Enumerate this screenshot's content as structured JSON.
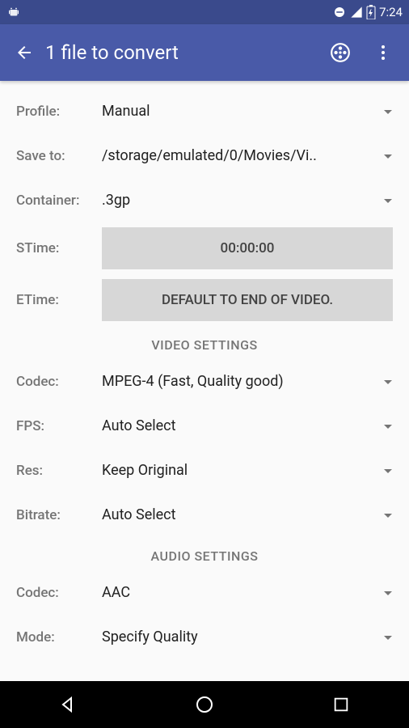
{
  "status": {
    "time": "7:24"
  },
  "appbar": {
    "title": "1 file to convert"
  },
  "rows": {
    "profile": {
      "label": "Profile:",
      "value": "Manual"
    },
    "saveto": {
      "label": "Save to:",
      "value": "/storage/emulated/0/Movies/Vi.."
    },
    "container": {
      "label": "Container:",
      "value": ".3gp"
    },
    "stime": {
      "label": "STime:",
      "button": "00:00:00"
    },
    "etime": {
      "label": "ETime:",
      "button": "DEFAULT TO END OF VIDEO."
    }
  },
  "sections": {
    "video": "VIDEO SETTINGS",
    "audio": "AUDIO SETTINGS"
  },
  "video": {
    "codec": {
      "label": "Codec:",
      "value": "MPEG-4 (Fast, Quality good)"
    },
    "fps": {
      "label": "FPS:",
      "value": "Auto Select"
    },
    "res": {
      "label": "Res:",
      "value": "Keep Original"
    },
    "bitrate": {
      "label": "Bitrate:",
      "value": "Auto Select"
    }
  },
  "audio": {
    "codec": {
      "label": "Codec:",
      "value": "AAC"
    },
    "mode": {
      "label": "Mode:",
      "value": "Specify Quality"
    }
  }
}
